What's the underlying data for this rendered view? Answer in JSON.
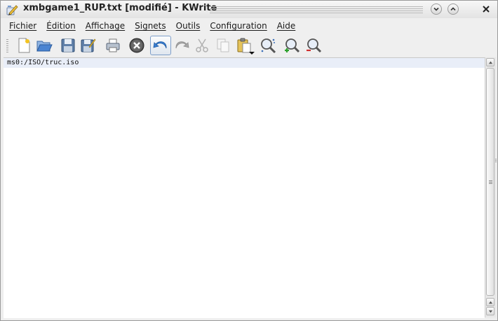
{
  "window": {
    "title": "xmbgame1_RUP.txt [modifié] - KWrite",
    "app_icon": "kwrite-pen-icon"
  },
  "title_buttons": [
    {
      "name": "minimize",
      "icon": "chevron-down-icon"
    },
    {
      "name": "maximize",
      "icon": "chevron-up-icon"
    },
    {
      "name": "close",
      "icon": "close-icon"
    }
  ],
  "menu": {
    "items": [
      "Fichier",
      "Édition",
      "Affichage",
      "Signets",
      "Outils",
      "Configuration",
      "Aide"
    ]
  },
  "toolbar": {
    "tools": [
      {
        "name": "new-document",
        "icon": "new-document-icon"
      },
      {
        "name": "open-document",
        "icon": "open-folder-icon"
      },
      {
        "name": "save",
        "icon": "save-icon"
      },
      {
        "name": "save-as",
        "icon": "save-as-icon"
      },
      {
        "name": "print",
        "icon": "printer-icon"
      },
      {
        "name": "close-document",
        "icon": "close-circle-icon"
      },
      {
        "name": "undo",
        "icon": "undo-icon",
        "active": true
      },
      {
        "name": "redo",
        "icon": "redo-icon"
      },
      {
        "name": "cut",
        "icon": "scissors-icon"
      },
      {
        "name": "copy",
        "icon": "copy-icon"
      },
      {
        "name": "paste",
        "icon": "paste-icon"
      },
      {
        "name": "find",
        "icon": "find-icon"
      },
      {
        "name": "zoom-in",
        "icon": "zoom-in-icon"
      },
      {
        "name": "zoom-out",
        "icon": "zoom-out-icon"
      }
    ]
  },
  "editor": {
    "lines": [
      "ms0:/ISO/truc.iso"
    ],
    "current_line_color": "#e9eef8"
  },
  "colors": {
    "accent": "#4a7cc4",
    "window_bg": "#eeeeee"
  }
}
